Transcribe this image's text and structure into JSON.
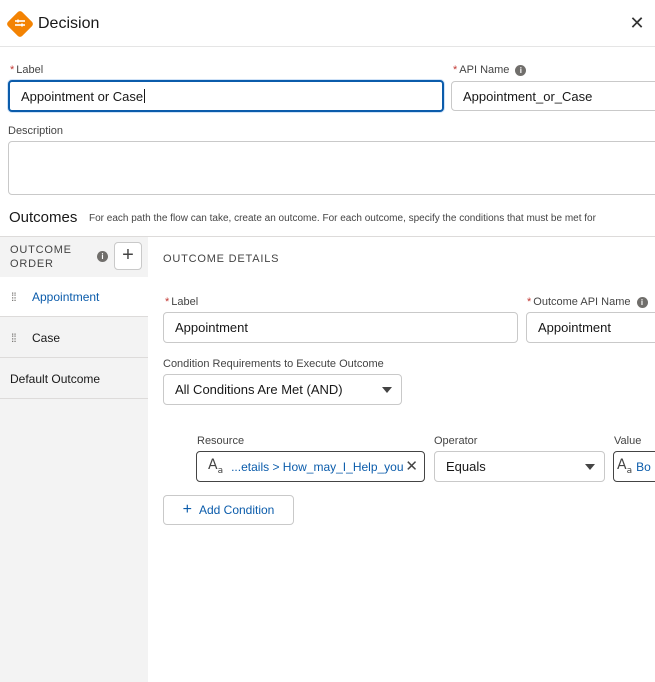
{
  "header": {
    "title": "Decision",
    "close_glyph": "✕",
    "icon": "decision-diamond-icon",
    "icon_color": "#f38303"
  },
  "form": {
    "label_caption": "Label",
    "label_value": "Appointment or Case",
    "api_name_caption": "API Name",
    "api_name_value": "Appointment_or_Case",
    "description_caption": "Description",
    "description_value": "",
    "required_marker": "*"
  },
  "outcomes": {
    "title": "Outcomes",
    "description": "For each path the flow can take, create an outcome. For each outcome, specify the conditions that must be met for",
    "order_header_line1": "OUTCOME",
    "order_header_line2": "ORDER",
    "add_glyph": "+",
    "items": [
      {
        "label": "Appointment",
        "active": true
      },
      {
        "label": "Case",
        "active": false
      },
      {
        "label": "Default Outcome",
        "active": false
      }
    ]
  },
  "details": {
    "header": "OUTCOME DETAILS",
    "label_caption": "Label",
    "label_value": "Appointment",
    "api_caption": "Outcome API Name",
    "api_value": "Appointment",
    "condition_req_caption": "Condition Requirements to Execute Outcome",
    "condition_req_value": "All Conditions Are Met (AND)",
    "condition": {
      "resource_caption": "Resource",
      "resource_value": "...etails > How_may_I_Help_you",
      "operator_caption": "Operator",
      "operator_value": "Equals",
      "value_caption": "Value",
      "value_value": "Bo"
    },
    "add_condition_label": "Add Condition",
    "add_condition_glyph": "+"
  },
  "colors": {
    "accent": "#0b5cab",
    "required": "#c23934",
    "sidebar_bg": "#f3f3f3"
  }
}
